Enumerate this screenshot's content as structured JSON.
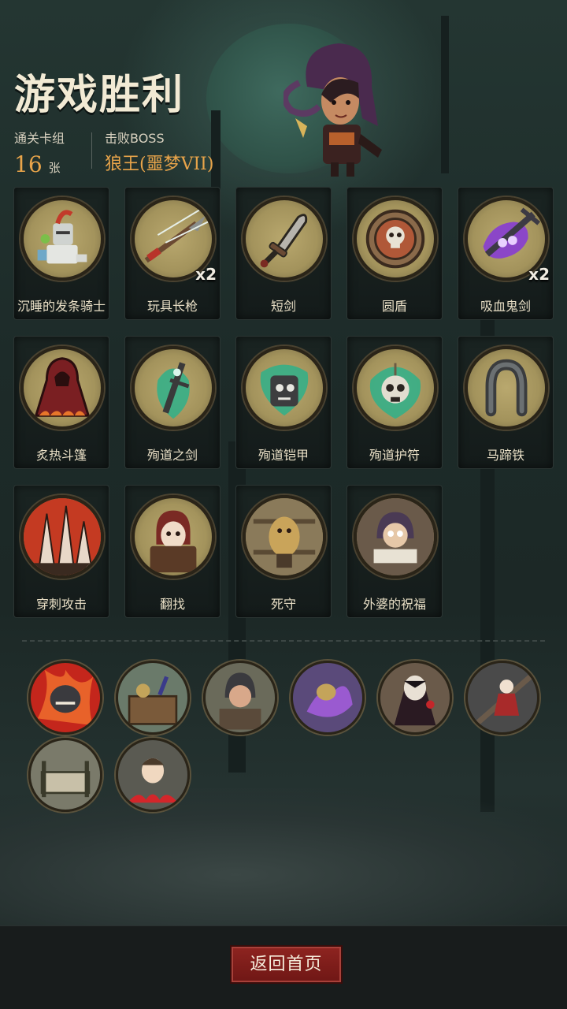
{
  "header": {
    "title": "游戏胜利",
    "deck_label": "通关卡组",
    "deck_count": "16",
    "deck_unit": "张",
    "boss_label": "击败BOSS",
    "boss_name": "狼王(噩梦VII)"
  },
  "cards": [
    {
      "name": "沉睡的发条骑士",
      "count": "",
      "icon": "clockwork-knight-icon"
    },
    {
      "name": "玩具长枪",
      "count": "x2",
      "icon": "toy-spear-icon"
    },
    {
      "name": "短剑",
      "count": "",
      "icon": "short-sword-icon"
    },
    {
      "name": "圆盾",
      "count": "",
      "icon": "round-shield-icon"
    },
    {
      "name": "吸血鬼剑",
      "count": "x2",
      "icon": "vampire-sword-icon"
    },
    {
      "name": "炙热斗篷",
      "count": "",
      "icon": "red-cloak-icon"
    },
    {
      "name": "殉道之剑",
      "count": "",
      "icon": "martyr-sword-icon"
    },
    {
      "name": "殉道铠甲",
      "count": "",
      "icon": "martyr-armor-icon"
    },
    {
      "name": "殉道护符",
      "count": "",
      "icon": "martyr-amulet-icon"
    },
    {
      "name": "马蹄铁",
      "count": "",
      "icon": "horseshoe-icon"
    },
    {
      "name": "穿刺攻击",
      "count": "",
      "icon": "pierce-attack-icon"
    },
    {
      "name": "翻找",
      "count": "",
      "icon": "rummage-icon"
    },
    {
      "name": "死守",
      "count": "",
      "icon": "hold-fast-icon"
    },
    {
      "name": "外婆的祝福",
      "count": "",
      "icon": "grandma-blessing-icon"
    }
  ],
  "relics": [
    {
      "icon": "fire-demon-relic-icon"
    },
    {
      "icon": "toy-box-relic-icon"
    },
    {
      "icon": "hooded-cook-relic-icon"
    },
    {
      "icon": "purple-beast-relic-icon"
    },
    {
      "icon": "vampire-relic-icon"
    },
    {
      "icon": "girl-stairs-relic-icon"
    },
    {
      "icon": "bed-relic-icon"
    },
    {
      "icon": "boy-fire-relic-icon"
    }
  ],
  "footer": {
    "home_button": "返回首页"
  },
  "colors": {
    "accent_gold": "#e8a44a",
    "button_red": "#8e2420"
  }
}
